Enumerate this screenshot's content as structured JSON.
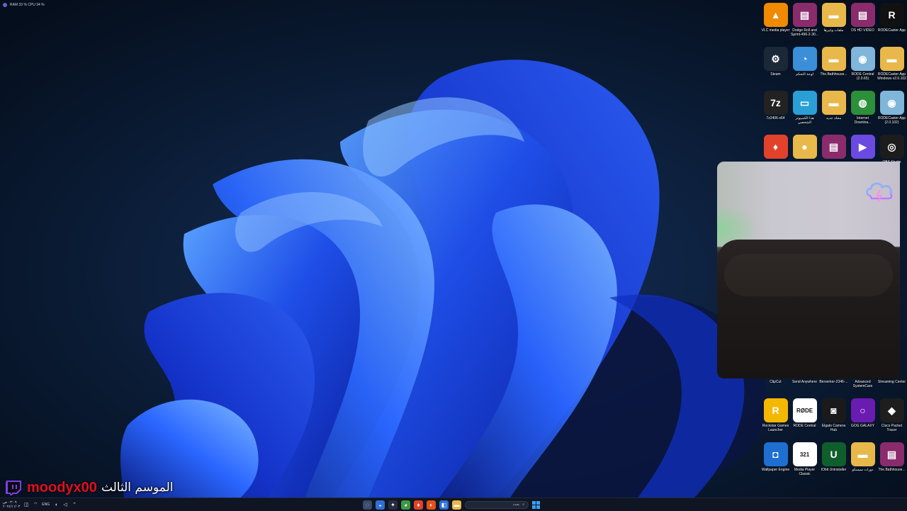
{
  "sysmon": {
    "text": "RAM 33 %   CPU 34 %"
  },
  "desktop_icons": [
    {
      "label": "VLC media player",
      "icon": "vlc-icon",
      "color": "#f08a00",
      "glyph": "▲"
    },
    {
      "label": "Dodge Roll and Sprint-496-2-30...",
      "icon": "winrar-icon",
      "color": "#8a2b6c",
      "glyph": "▤"
    },
    {
      "label": "ملفات وغيرها",
      "icon": "folder-icon",
      "color": "#e8b84a",
      "glyph": "▬"
    },
    {
      "label": "DS HD VIDEO",
      "icon": "winrar-icon",
      "color": "#8a2b6c",
      "glyph": "▤"
    },
    {
      "label": "RODECaster App",
      "icon": "rodecaster-icon",
      "color": "#111111",
      "glyph": "R"
    },
    {
      "label": "Steam",
      "icon": "steam-icon",
      "color": "#1b2838",
      "glyph": "⚙"
    },
    {
      "label": "لوحة التحكم",
      "icon": "control-panel-icon",
      "color": "#3b8ed8",
      "glyph": "◔"
    },
    {
      "label": "The.Bathhouse...",
      "icon": "folder-icon",
      "color": "#e8b84a",
      "glyph": "▬"
    },
    {
      "label": "RODE Central (2.0.65)",
      "icon": "disc-icon",
      "color": "#7fb6d9",
      "glyph": "◉"
    },
    {
      "label": "RODECaster App Windows v2.0.102",
      "icon": "folder-icon",
      "color": "#e8b84a",
      "glyph": "▬"
    },
    {
      "label": "7z2406-x64",
      "icon": "7zip-icon",
      "color": "#222222",
      "glyph": "7z"
    },
    {
      "label": "هذا الكمبيوتر الشخصي",
      "icon": "computer-icon",
      "color": "#2a9fd6",
      "glyph": "▭"
    },
    {
      "label": "مجلد جديد",
      "icon": "folder-icon",
      "color": "#e8b84a",
      "glyph": "▬"
    },
    {
      "label": "Internet Downloa...",
      "icon": "idm-icon",
      "color": "#2c8f3a",
      "glyph": "◍"
    },
    {
      "label": "RODECaster App (2.0.102)",
      "icon": "disc-icon",
      "color": "#7fb6d9",
      "glyph": "◉"
    },
    {
      "label": "",
      "icon": "brave-icon",
      "color": "#e2422b",
      "glyph": "♦"
    },
    {
      "label": "",
      "icon": "user-folder-icon",
      "color": "#e8b84a",
      "glyph": "●"
    },
    {
      "label": "",
      "icon": "winrar-icon",
      "color": "#8a2b6c",
      "glyph": "▤"
    },
    {
      "label": "",
      "icon": "play-icon",
      "color": "#6a4ae0",
      "glyph": "▶"
    },
    {
      "label": "OBS Studio",
      "icon": "obs-icon",
      "color": "#1c1c1c",
      "glyph": "◎"
    },
    {
      "label": "",
      "icon": "blank-icon",
      "color": "transparent",
      "glyph": ""
    },
    {
      "label": "",
      "icon": "blank-icon",
      "color": "transparent",
      "glyph": ""
    },
    {
      "label": "",
      "icon": "blank-icon",
      "color": "transparent",
      "glyph": ""
    },
    {
      "label": "",
      "icon": "blank-icon",
      "color": "transparent",
      "glyph": ""
    },
    {
      "label": "",
      "icon": "blank-icon",
      "color": "transparent",
      "glyph": ""
    },
    {
      "label": "",
      "icon": "blank-icon",
      "color": "transparent",
      "glyph": ""
    },
    {
      "label": "",
      "icon": "blank-icon",
      "color": "transparent",
      "glyph": ""
    },
    {
      "label": "",
      "icon": "blank-icon",
      "color": "transparent",
      "glyph": ""
    },
    {
      "label": "",
      "icon": "blank-icon",
      "color": "transparent",
      "glyph": ""
    },
    {
      "label": "",
      "icon": "blank-icon",
      "color": "transparent",
      "glyph": ""
    },
    {
      "label": "",
      "icon": "blank-icon",
      "color": "transparent",
      "glyph": ""
    },
    {
      "label": "",
      "icon": "blank-icon",
      "color": "transparent",
      "glyph": ""
    },
    {
      "label": "",
      "icon": "blank-icon",
      "color": "transparent",
      "glyph": ""
    },
    {
      "label": "",
      "icon": "blank-icon",
      "color": "transparent",
      "glyph": ""
    },
    {
      "label": "",
      "icon": "blank-icon",
      "color": "transparent",
      "glyph": ""
    },
    {
      "label": "",
      "icon": "blank-icon",
      "color": "transparent",
      "glyph": ""
    },
    {
      "label": "",
      "icon": "blank-icon",
      "color": "transparent",
      "glyph": ""
    },
    {
      "label": "",
      "icon": "blank-icon",
      "color": "transparent",
      "glyph": ""
    },
    {
      "label": "",
      "icon": "blank-icon",
      "color": "transparent",
      "glyph": ""
    },
    {
      "label": "",
      "icon": "blank-icon",
      "color": "transparent",
      "glyph": ""
    },
    {
      "label": "ClipCut",
      "icon": "clipcut-icon",
      "color": "transparent",
      "glyph": ""
    },
    {
      "label": "Send Anywhere",
      "icon": "send-anywhere-icon",
      "color": "transparent",
      "glyph": ""
    },
    {
      "label": "Berserker-2346-...",
      "icon": "winrar-icon",
      "color": "transparent",
      "glyph": ""
    },
    {
      "label": "Advanced SystemCare",
      "icon": "systemcare-icon",
      "color": "transparent",
      "glyph": ""
    },
    {
      "label": "Streaming Center",
      "icon": "streaming-center-icon",
      "color": "transparent",
      "glyph": ""
    },
    {
      "label": "Rockstar Games Launcher",
      "icon": "rockstar-icon",
      "color": "#f5b800",
      "glyph": "R"
    },
    {
      "label": "RODE Central",
      "icon": "rode-central-icon",
      "color": "#ffffff",
      "glyph": "RØDE"
    },
    {
      "label": "Elgato Camera Hub",
      "icon": "elgato-icon",
      "color": "#1a1a1a",
      "glyph": "◙"
    },
    {
      "label": "GOG GALAXY",
      "icon": "gog-icon",
      "color": "#6a1bb0",
      "glyph": "○"
    },
    {
      "label": "Cisco Packet Tracer",
      "icon": "cisco-icon",
      "color": "#1e1e1e",
      "glyph": "◆"
    },
    {
      "label": "Wallpaper Engine",
      "icon": "wallpaper-engine-icon",
      "color": "#1e6fd0",
      "glyph": "◘"
    },
    {
      "label": "Media Player Classic",
      "icon": "mpc-icon",
      "color": "#ffffff",
      "glyph": "321"
    },
    {
      "label": "IObit Uninstaller",
      "icon": "iobit-icon",
      "color": "#0f5f2d",
      "glyph": "U"
    },
    {
      "label": "دورات سيسكو",
      "icon": "folder-icon",
      "color": "#e8b84a",
      "glyph": "▬"
    },
    {
      "label": "The.Bathhouse...",
      "icon": "winrar-icon",
      "color": "#8a2b6c",
      "glyph": "▤"
    }
  ],
  "overlay": {
    "streamer_name": "moodyx00",
    "season_text": "الموسم الثالث"
  },
  "taskbar": {
    "time": "٠٣:٠٩ ص",
    "date": "٢٠٢٤/١١/٠٣",
    "language": "ENG",
    "search_placeholder": "بحث",
    "apps": [
      {
        "icon": "copilot-icon",
        "color": "#3a4a6a",
        "glyph": "◌"
      },
      {
        "icon": "edge-icon",
        "color": "#2f6fd6",
        "glyph": "◒"
      },
      {
        "icon": "chatgpt-icon",
        "color": "#2b2b40",
        "glyph": "✦"
      },
      {
        "icon": "chrome-icon",
        "color": "#3c9a45",
        "glyph": "◕"
      },
      {
        "icon": "brave-icon",
        "color": "#e2422b",
        "glyph": "♦"
      },
      {
        "icon": "firefox-icon",
        "color": "#e3521b",
        "glyph": "◐"
      },
      {
        "icon": "store-icon",
        "color": "#2a6dd8",
        "glyph": "◧"
      },
      {
        "icon": "explorer-icon",
        "color": "#e8b84a",
        "glyph": "▬"
      }
    ]
  },
  "colors": {
    "streamer_name": "#e0101e",
    "twitch_purple": "#7d3fe0",
    "wallpaper_bg": "#071426",
    "wallpaper_bloom": "#1f4fe8"
  }
}
